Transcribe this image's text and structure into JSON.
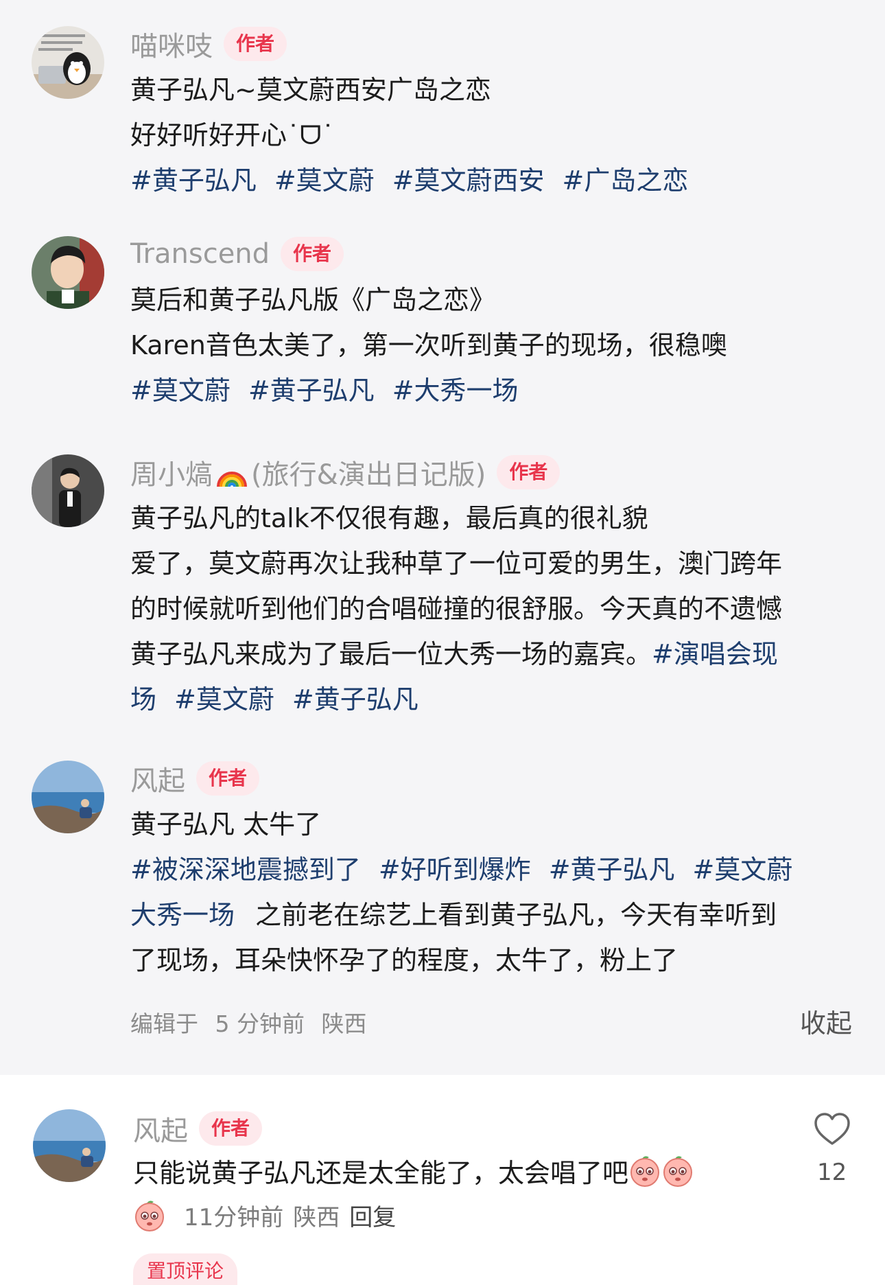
{
  "posts": [
    {
      "name": "喵咪吱",
      "badge": "作者",
      "lines": [
        "黄子弘凡~莫文蔚西安广岛之恋",
        "好好听好开心˙ᗜ˙"
      ],
      "tags": [
        "#黄子弘凡",
        "#莫文蔚",
        "#莫文蔚西安",
        "#广岛之恋"
      ]
    },
    {
      "name": "Transcend",
      "badge": "作者",
      "lines": [
        "莫后和黄子弘凡版《广岛之恋》",
        "Karen音色太美了，第一次听到黄子的现场，很稳噢"
      ],
      "tags": [
        "#莫文蔚",
        "#黄子弘凡",
        "#大秀一场"
      ]
    },
    {
      "name_main": "周小熇",
      "name_suffix": "(旅行&演出日记版)",
      "badge": "作者",
      "lines": [
        "黄子弘凡的talk不仅很有趣，最后真的很礼貌",
        "爱了，莫文蔚再次让我种草了一位可爱的男生，澳门跨年",
        "的时候就听到他们的合唱碰撞的很舒服。今天真的不遗憾",
        "黄子弘凡来成为了最后一位大秀一场的嘉宾。"
      ],
      "tag_inline": "#演唱会现",
      "tag_cont": "场",
      "tags": [
        "#莫文蔚",
        "#黄子弘凡"
      ]
    },
    {
      "name": "风起",
      "badge": "作者",
      "line1": "黄子弘凡  太牛了",
      "tags_row1": [
        "#被深深地震撼到了",
        "#好听到爆炸",
        "#黄子弘凡",
        "#莫文蔚"
      ],
      "tag_row2": "大秀一场",
      "text_row2": "之前老在综艺上看到黄子弘凡，今天有幸听到",
      "line4": "了现场，耳朵快怀孕了的程度，太牛了，粉上了"
    }
  ],
  "meta": {
    "edited": "编辑于",
    "time": "5 分钟前",
    "location": "陕西",
    "collapse": "收起"
  },
  "comment": {
    "name": "风起",
    "badge": "作者",
    "text": "只能说黄子弘凡还是太全能了，太会唱了吧",
    "time": "11分钟前",
    "location": "陕西",
    "reply": "回复",
    "likes": "12",
    "pinned": "置顶评论"
  },
  "icons": {
    "heart": "heart-icon",
    "emoji": "peach-emoji-icon"
  }
}
